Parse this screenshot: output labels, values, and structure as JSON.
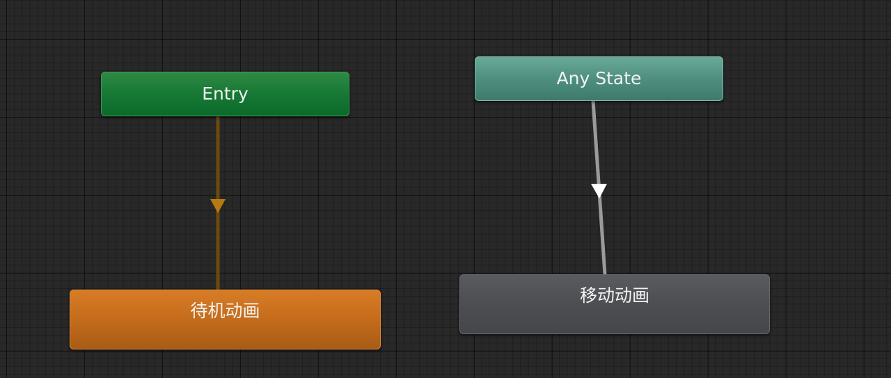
{
  "graph": {
    "nodes": {
      "entry": {
        "label": "Entry",
        "color": "#1a7a35"
      },
      "any_state": {
        "label": "Any State",
        "color": "#4f9282"
      },
      "idle": {
        "label": "待机动画",
        "color": "#c46c1c"
      },
      "move": {
        "label": "移动动画",
        "color": "#4c4e52"
      }
    },
    "transitions": [
      {
        "from": "Entry",
        "to": "待机动画",
        "color": "#6b4a10"
      },
      {
        "from": "Any State",
        "to": "移动动画",
        "color": "#9a9a9a"
      }
    ]
  }
}
